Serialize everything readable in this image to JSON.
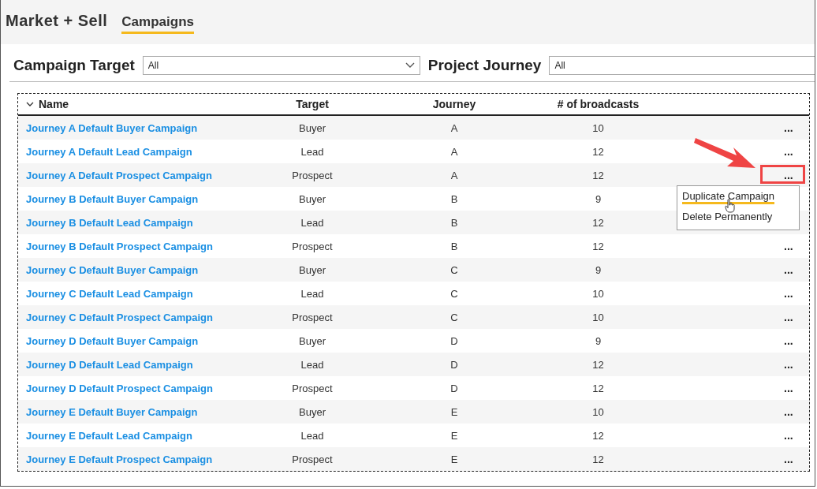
{
  "header": {
    "title": "Market + Sell",
    "tabs": [
      {
        "label": "Campaigns",
        "selected": true
      }
    ]
  },
  "filters": [
    {
      "label": "Campaign Target",
      "value": "All"
    },
    {
      "label": "Project Journey",
      "value": "All"
    }
  ],
  "table": {
    "columns": [
      "Name",
      "Target",
      "Journey",
      "# of broadcasts"
    ],
    "rows": [
      {
        "name": "Journey A Default Buyer Campaign",
        "target": "Buyer",
        "journey": "A",
        "broadcasts": "10",
        "actions": "...",
        "menu_open": false
      },
      {
        "name": "Journey A Default Lead Campaign",
        "target": "Lead",
        "journey": "A",
        "broadcasts": "12",
        "actions": "...",
        "menu_open": false
      },
      {
        "name": "Journey A Default Prospect Campaign",
        "target": "Prospect",
        "journey": "A",
        "broadcasts": "12",
        "actions": "...",
        "menu_open": true
      },
      {
        "name": "Journey B Default Buyer Campaign",
        "target": "Buyer",
        "journey": "B",
        "broadcasts": "9",
        "menu_open": false
      },
      {
        "name": "Journey B Default Lead Campaign",
        "target": "Lead",
        "journey": "B",
        "broadcasts": "12",
        "menu_open": false
      },
      {
        "name": "Journey B Default Prospect Campaign",
        "target": "Prospect",
        "journey": "B",
        "broadcasts": "12",
        "actions": "...",
        "menu_open": false
      },
      {
        "name": "Journey C Default Buyer Campaign",
        "target": "Buyer",
        "journey": "C",
        "broadcasts": "9",
        "actions": "...",
        "menu_open": false
      },
      {
        "name": "Journey C Default Lead Campaign",
        "target": "Lead",
        "journey": "C",
        "broadcasts": "10",
        "actions": "...",
        "menu_open": false
      },
      {
        "name": "Journey C Default Prospect Campaign",
        "target": "Prospect",
        "journey": "C",
        "broadcasts": "10",
        "actions": "...",
        "menu_open": false
      },
      {
        "name": "Journey D Default Buyer Campaign",
        "target": "Buyer",
        "journey": "D",
        "broadcasts": "9",
        "actions": "...",
        "menu_open": false
      },
      {
        "name": "Journey D Default Lead Campaign",
        "target": "Lead",
        "journey": "D",
        "broadcasts": "12",
        "actions": "...",
        "menu_open": false
      },
      {
        "name": "Journey D Default Prospect Campaign",
        "target": "Prospect",
        "journey": "D",
        "broadcasts": "12",
        "actions": "...",
        "menu_open": false
      },
      {
        "name": "Journey E Default Buyer Campaign",
        "target": "Buyer",
        "journey": "E",
        "broadcasts": "10",
        "actions": "...",
        "menu_open": false
      },
      {
        "name": "Journey E Default Lead Campaign",
        "target": "Lead",
        "journey": "E",
        "broadcasts": "12",
        "actions": "...",
        "menu_open": false
      },
      {
        "name": "Journey E Default Prospect Campaign",
        "target": "Prospect",
        "journey": "E",
        "broadcasts": "12",
        "actions": "...",
        "menu_open": false
      }
    ]
  },
  "context_menu": {
    "items": [
      {
        "label": "Duplicate Campaign",
        "selected": true
      },
      {
        "label": "Delete Permanently",
        "selected": false
      }
    ]
  }
}
